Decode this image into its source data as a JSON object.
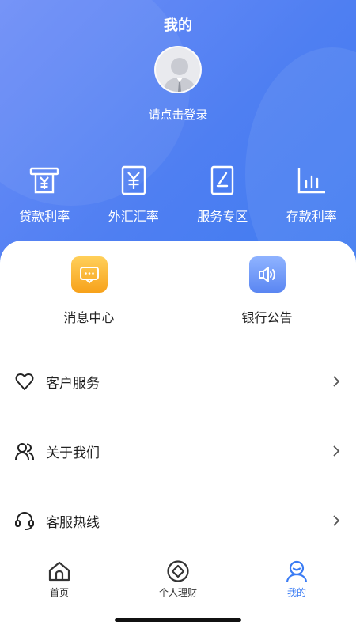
{
  "header": {
    "title": "我的",
    "login_prompt": "请点击登录"
  },
  "quick_actions": [
    {
      "label": "贷款利率",
      "icon": "loan-rate-icon"
    },
    {
      "label": "外汇汇率",
      "icon": "forex-rate-icon"
    },
    {
      "label": "服务专区",
      "icon": "service-zone-icon"
    },
    {
      "label": "存款利率",
      "icon": "deposit-rate-icon"
    }
  ],
  "notices": [
    {
      "label": "消息中心",
      "icon": "message-icon",
      "color": "#f7a21b"
    },
    {
      "label": "银行公告",
      "icon": "speaker-icon",
      "color": "#5a86f2"
    }
  ],
  "menu": [
    {
      "label": "客户服务",
      "icon": "heart-icon"
    },
    {
      "label": "关于我们",
      "icon": "users-icon"
    },
    {
      "label": "客服热线",
      "icon": "headset-icon"
    }
  ],
  "tabbar": {
    "items": [
      {
        "label": "首页",
        "icon": "home-icon",
        "active": false
      },
      {
        "label": "个人理财",
        "icon": "finance-icon",
        "active": false
      },
      {
        "label": "我的",
        "icon": "profile-icon",
        "active": true
      }
    ]
  },
  "colors": {
    "header_gradient_start": "#6e8ef7",
    "header_gradient_end": "#3f7bf0",
    "accent": "#3b7cf4",
    "notice_orange": "#f7a21b",
    "notice_blue": "#5a86f2"
  }
}
